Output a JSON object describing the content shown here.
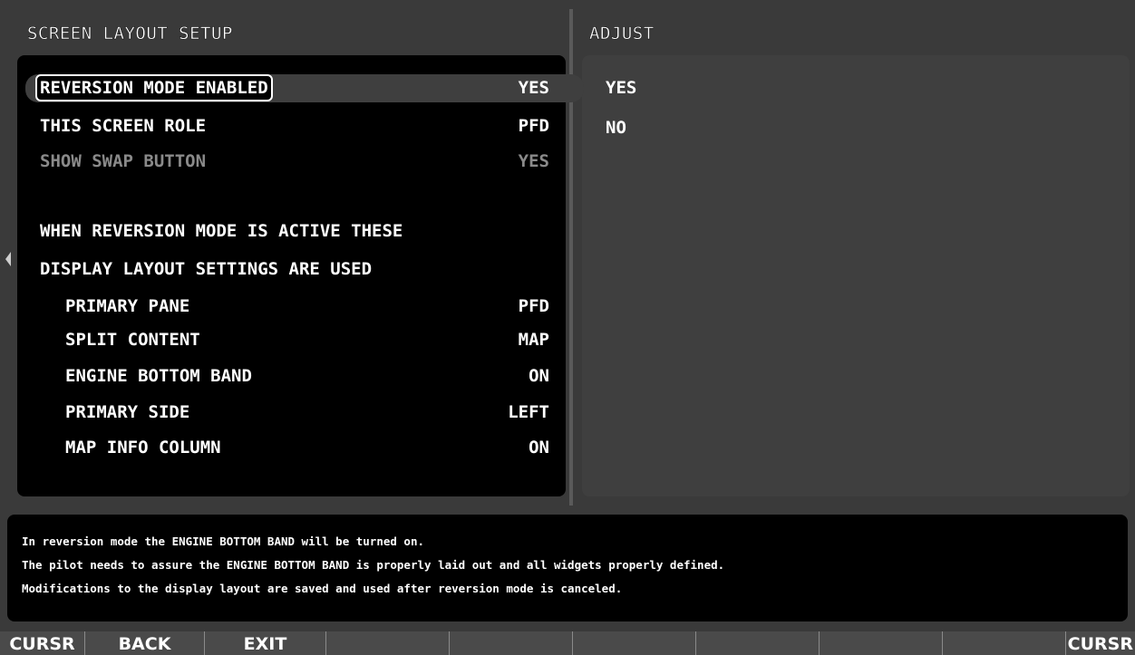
{
  "left_title": "SCREEN LAYOUT SETUP",
  "right_title": "ADJUST",
  "settings": [
    {
      "label": "REVERSION MODE ENABLED",
      "value": "YES"
    },
    {
      "label": "THIS SCREEN ROLE",
      "value": "PFD"
    },
    {
      "label": "SHOW SWAP BUTTON",
      "value": "YES"
    }
  ],
  "note": {
    "line1": "WHEN REVERSION MODE IS ACTIVE THESE",
    "line2": "DISPLAY LAYOUT SETTINGS ARE USED"
  },
  "layout_settings": [
    {
      "label": "PRIMARY PANE",
      "value": "PFD"
    },
    {
      "label": "SPLIT CONTENT",
      "value": "MAP"
    },
    {
      "label": "ENGINE BOTTOM BAND",
      "value": "ON"
    },
    {
      "label": "PRIMARY SIDE",
      "value": "LEFT"
    },
    {
      "label": "MAP INFO COLUMN",
      "value": "ON"
    }
  ],
  "adjust_options": [
    "YES",
    "NO"
  ],
  "message": [
    "In reversion mode the ENGINE BOTTOM BAND will be turned on.",
    "The pilot needs to assure the ENGINE BOTTOM BAND is properly laid out and all widgets properly defined.",
    "Modifications to the display layout are saved and used after reversion mode is canceled."
  ],
  "softkeys": [
    "CURSR",
    "BACK",
    "EXIT",
    "",
    "",
    "",
    "",
    "",
    "",
    "CURSR"
  ]
}
